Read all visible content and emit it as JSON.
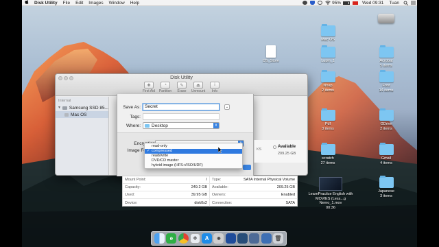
{
  "menubar": {
    "app_name": "Disk Utility",
    "menus": [
      "File",
      "Edit",
      "Images",
      "Window",
      "Help"
    ],
    "battery": "95%",
    "clock": "Wed 09:31",
    "user": "Tuan"
  },
  "window": {
    "title": "Disk Utility",
    "toolbar": [
      "First Aid",
      "Partition",
      "Erase",
      "Unmount",
      "Info"
    ]
  },
  "sidebar": {
    "section": "Internal",
    "items": [
      "Samsung SSD 85...",
      "Mac OS"
    ]
  },
  "sheet": {
    "save_as_label": "Save As:",
    "save_as_value": "Secret",
    "tags_label": "Tags:",
    "where_label": "Where:",
    "where_value": "Desktop",
    "encryption_label": "Encryption",
    "image_format_label": "Image Format",
    "available_label": "Available",
    "available_value": "209.25 GB",
    "ks_text": "KS",
    "format_options": [
      "read-only",
      "compressed",
      "read/write",
      "DVD/CD master",
      "hybrid image (HFS+/ISO/UDF)"
    ],
    "selected_format": "compressed"
  },
  "info": {
    "rows": [
      {
        "k1": "Mount Point:",
        "v1": "/",
        "k2": "Type:",
        "v2": "SATA Internal Physical Volume"
      },
      {
        "k1": "Capacity:",
        "v1": "249.2 GB",
        "k2": "Available:",
        "v2": "209.25 GB"
      },
      {
        "k1": "Used:",
        "v1": "39.95 GB",
        "k2": "Owners:",
        "v2": "Enabled"
      },
      {
        "k1": "Device:",
        "v1": "disk0s2",
        "k2": "Connection:",
        "v2": "SATA"
      }
    ]
  },
  "desktop": {
    "items": [
      {
        "name": "Mac OS",
        "sub": ""
      },
      {
        "name": "DS_Store",
        "sub": ""
      },
      {
        "name": "Lupin_1",
        "sub": ""
      },
      {
        "name": "Lupin_2",
        "sub": ""
      },
      {
        "name": "Acrobat",
        "sub": "5 items"
      },
      {
        "name": "Nhap",
        "sub": "2 items"
      },
      {
        "name": "Font",
        "sub": "14 items"
      },
      {
        "name": "Pdf",
        "sub": "3 items"
      },
      {
        "name": "GDrive",
        "sub": "2 items"
      },
      {
        "name": "scratch",
        "sub": "27 items"
      },
      {
        "name": "Gmail",
        "sub": "4 items"
      },
      {
        "name": "Japanese",
        "sub": "3 items"
      },
      {
        "name": "LearnPractice English with MOVIES (Less...g Nemo_1.mov",
        "sub": "00:36"
      }
    ]
  },
  "colors": {
    "selection": "#2f7ae0",
    "folder": "#7dc6f2"
  }
}
